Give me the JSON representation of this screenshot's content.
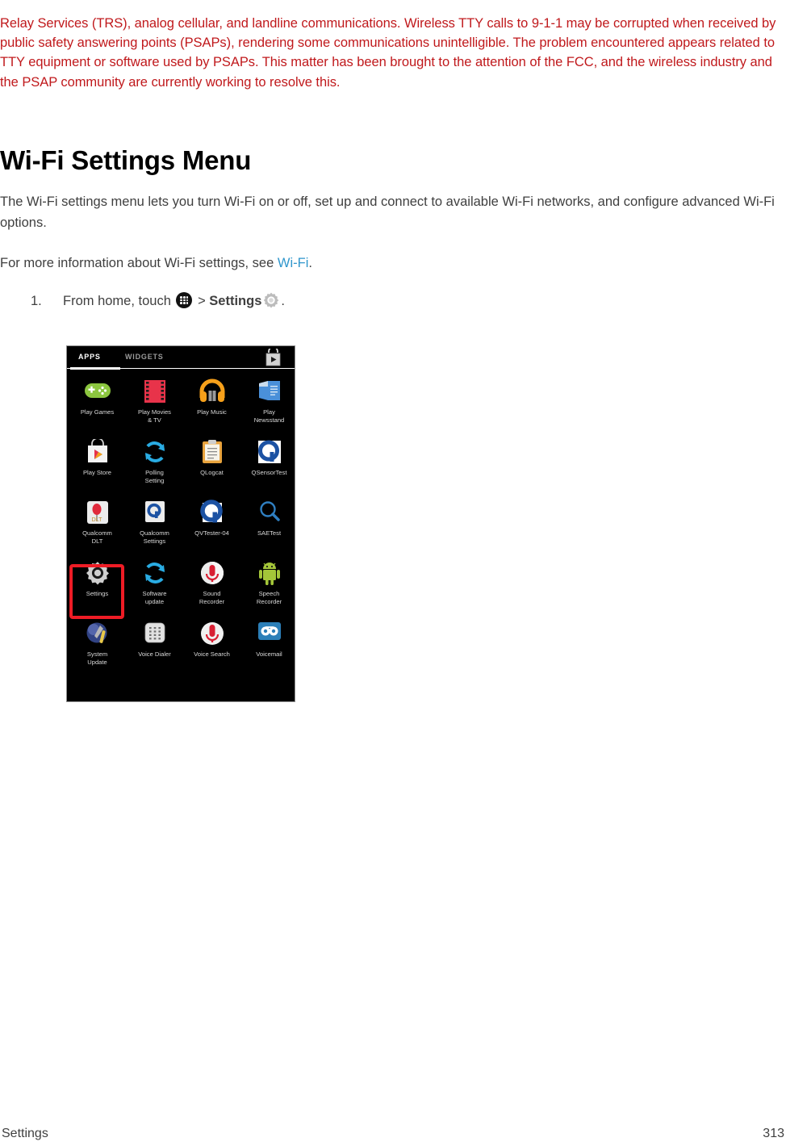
{
  "document": {
    "continuation_paragraph": "Relay Services (TRS), analog cellular, and landline communications. Wireless TTY calls to 9-1-1 may be corrupted when received by public safety answering points (PSAPs), rendering some communications unintelligible. The problem encountered appears related to TTY equipment or software used by PSAPs. This matter has been brought to the attention of the FCC, and the wireless industry and the PSAP community are currently working to resolve this.",
    "heading": "Wi-Fi Settings Menu",
    "paragraph_1": "The Wi-Fi settings menu lets you turn Wi-Fi on or off, set up and connect to available Wi-Fi networks, and configure advanced Wi-Fi options.",
    "paragraph_2_before_link": "For more information about Wi-Fi settings, see ",
    "paragraph_2_link": "Wi-Fi",
    "paragraph_2_after_link": ".",
    "colors": {
      "warning_text": "#c0191c",
      "body_text": "#3f3f3f",
      "link": "#2f96cc",
      "highlight_box": "#ee1c25"
    }
  },
  "steps": [
    {
      "number": "1.",
      "text_before_apps_icon": "From home, touch ",
      "apps_icon": "apps-grid-icon",
      "text_between": " > ",
      "bold_label": "Settings",
      "gear_icon": "gear-icon",
      "text_after": "."
    }
  ],
  "screenshot": {
    "tabs": [
      {
        "label": "APPS",
        "active": true
      },
      {
        "label": "WIDGETS",
        "active": false
      }
    ],
    "store_icon": "play-store-bag-icon",
    "highlighted_app": "Settings",
    "apps": [
      {
        "label": "Play Games",
        "icon": "gamepad-icon"
      },
      {
        "label": "Play Movies\n& TV",
        "icon": "film-strip-icon"
      },
      {
        "label": "Play Music",
        "icon": "headphones-icon"
      },
      {
        "label": "Play\nNewsstand",
        "icon": "newspaper-icon"
      },
      {
        "label": "Play Store",
        "icon": "shopping-bag-icon"
      },
      {
        "label": "Polling\nSetting",
        "icon": "refresh-arrows-icon"
      },
      {
        "label": "QLogcat",
        "icon": "clipboard-icon"
      },
      {
        "label": "QSensorTest",
        "icon": "qualcomm-q-icon"
      },
      {
        "label": "Qualcomm\nDLT",
        "icon": "balloon-icon"
      },
      {
        "label": "Qualcomm\nSettings",
        "icon": "qualcomm-q-small-icon"
      },
      {
        "label": "QVTester-04",
        "icon": "qualcomm-q-icon"
      },
      {
        "label": "SAETest",
        "icon": "magnifier-icon"
      },
      {
        "label": "Settings",
        "icon": "gear-icon"
      },
      {
        "label": "Software\nupdate",
        "icon": "refresh-arrows-icon"
      },
      {
        "label": "Sound\nRecorder",
        "icon": "microphone-red-icon"
      },
      {
        "label": "Speech\nRecorder",
        "icon": "android-robot-icon"
      },
      {
        "label": "System\nUpdate",
        "icon": "tools-sphere-icon"
      },
      {
        "label": "Voice Dialer",
        "icon": "keypad-icon"
      },
      {
        "label": "Voice Search",
        "icon": "microphone-icon"
      },
      {
        "label": "Voicemail",
        "icon": "voicemail-tape-icon"
      }
    ]
  },
  "footer": {
    "section": "Settings",
    "page_number": "313"
  }
}
